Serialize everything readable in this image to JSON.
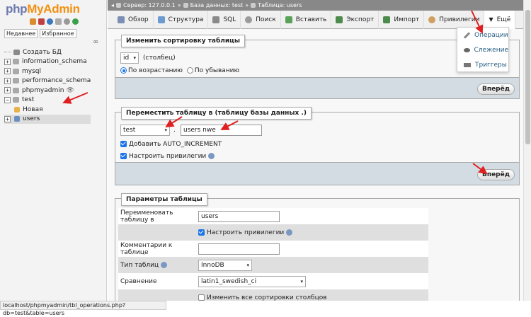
{
  "app": {
    "logo_php": "php",
    "logo_my": "My",
    "logo_admin": "Admin"
  },
  "sidebar": {
    "recent": "Недавнее",
    "favorites": "Избранное",
    "items": [
      {
        "label": "Создать БД",
        "type": "new"
      },
      {
        "label": "information_schema",
        "type": "db"
      },
      {
        "label": "mysql",
        "type": "db"
      },
      {
        "label": "performance_schema",
        "type": "db"
      },
      {
        "label": "phpmyadmin",
        "type": "db"
      },
      {
        "label": "test",
        "type": "db-open"
      },
      {
        "label": "Новая",
        "type": "sub-new"
      },
      {
        "label": "users",
        "type": "sub-table"
      }
    ]
  },
  "breadcrumb": {
    "server": "Сервер: 127.0.0.1",
    "db": "База данных: test",
    "table": "Таблица: users",
    "sep": "»"
  },
  "tabs": [
    {
      "label": "Обзор",
      "color": "#7a8fb3"
    },
    {
      "label": "Структура",
      "color": "#6b9bd1"
    },
    {
      "label": "SQL",
      "color": "#8a8a8a"
    },
    {
      "label": "Поиск",
      "color": "#9b9b9b"
    },
    {
      "label": "Вставить",
      "color": "#59a159"
    },
    {
      "label": "Экспорт",
      "color": "#4c8b4c"
    },
    {
      "label": "Импорт",
      "color": "#4c8b4c"
    },
    {
      "label": "Привилегии",
      "color": "#d0a060"
    },
    {
      "label": "Ещё",
      "color": "#444444"
    }
  ],
  "dropdown": [
    {
      "label": "Операции"
    },
    {
      "label": "Слежение"
    },
    {
      "label": "Триггеры"
    }
  ],
  "sort": {
    "legend": "Изменить сортировку таблицы",
    "column": "id",
    "column_suffix": "(столбец)",
    "asc": "По возрастанию",
    "desc": "По убыванию",
    "go": "Вперёд"
  },
  "move": {
    "legend": "Переместить таблицу в (таблицу базы данных .)",
    "db": "test",
    "dot": ".",
    "table": "users nwe",
    "auto_inc": "Добавить AUTO_INCREMENT",
    "privs": "Настроить привилегии",
    "go": "Вперёд"
  },
  "params": {
    "legend": "Параметры таблицы",
    "rename_label": "Переименовать таблицу в",
    "rename_value": "users",
    "privs": "Настроить привилегии",
    "comment_label": "Комментарии к таблице",
    "comment_value": "",
    "engine_label": "Тип таблиц",
    "engine_value": "InnoDB",
    "collation_label": "Сравнение",
    "collation_value": "latin1_swedish_ci",
    "change_all": "Изменить все сортировки столбцов"
  },
  "status_url": "localhost/phpmyadmin/tbl_operations.php?db=test&table=users",
  "colors": {
    "accent": "#235a81",
    "arrow": "#e02020"
  }
}
